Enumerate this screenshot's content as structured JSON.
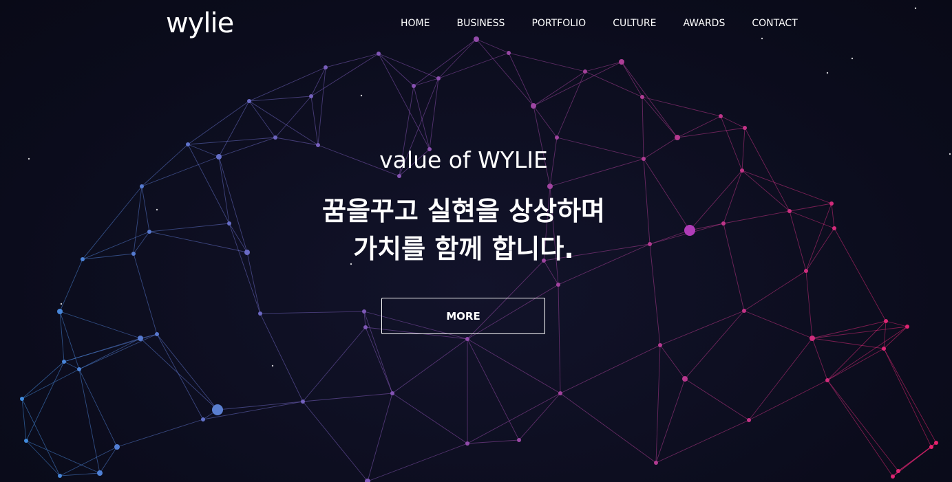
{
  "header": {
    "logo": "wylie",
    "nav": [
      "HOME",
      "BUSINESS",
      "PORTFOLIO",
      "CULTURE",
      "AWARDS",
      "CONTACT"
    ]
  },
  "hero": {
    "subtitle": "value of WYLIE",
    "headline_line1": "꿈을꾸고 실현을 상상하며",
    "headline_line2": "가치를 함께 합니다.",
    "button": "MORE"
  },
  "colors": {
    "background": "#0b0c1c",
    "network_left": "#4a8fd8",
    "network_mid": "#8a4fb0",
    "network_right": "#e0206a",
    "text": "#ffffff"
  }
}
